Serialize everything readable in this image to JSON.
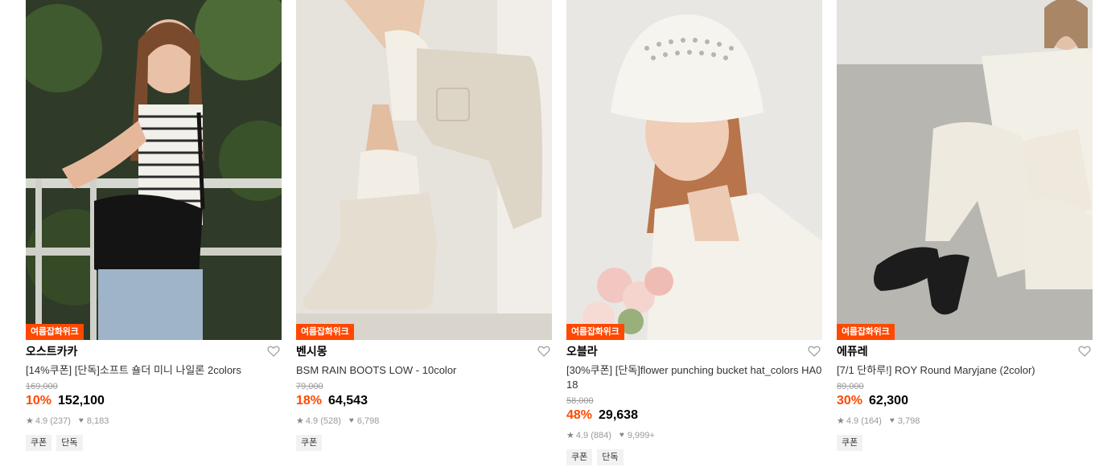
{
  "colors": {
    "accent": "#ff4800",
    "muted": "#999999",
    "tag_bg": "#f2f2f2"
  },
  "icons": {
    "wish": "heart-outline-icon",
    "rating": "star-icon",
    "likes": "heart-icon"
  },
  "products": [
    {
      "badge": "여름잡화위크",
      "brand": "오스트카카",
      "title": "[14%쿠폰] [단독]소프트 숄더 미니 나일론 2colors",
      "original_price": "169,000",
      "discount": "10%",
      "price": "152,100",
      "rating": "4.9",
      "reviews": "(237)",
      "likes": "8,183",
      "tags": [
        "쿠폰",
        "단독"
      ]
    },
    {
      "badge": "여름잡화위크",
      "brand": "벤시몽",
      "title": "BSM RAIN BOOTS LOW - 10color",
      "original_price": "79,000",
      "discount": "18%",
      "price": "64,543",
      "rating": "4.9",
      "reviews": "(528)",
      "likes": "6,798",
      "tags": [
        "쿠폰"
      ]
    },
    {
      "badge": "여름잡화위크",
      "brand": "오블라",
      "title": "[30%쿠폰] [단독]flower punching bucket hat_colors HA018",
      "original_price": "58,000",
      "discount": "48%",
      "price": "29,638",
      "rating": "4.9",
      "reviews": "(884)",
      "likes": "9,999+",
      "tags": [
        "쿠폰",
        "단독"
      ]
    },
    {
      "badge": "여름잡화위크",
      "brand": "에퓨레",
      "title": "[7/1 단하루!] ROY Round Maryjane (2color)",
      "original_price": "89,000",
      "discount": "30%",
      "price": "62,300",
      "rating": "4.9",
      "reviews": "(164)",
      "likes": "3,798",
      "tags": [
        "쿠폰"
      ]
    }
  ]
}
